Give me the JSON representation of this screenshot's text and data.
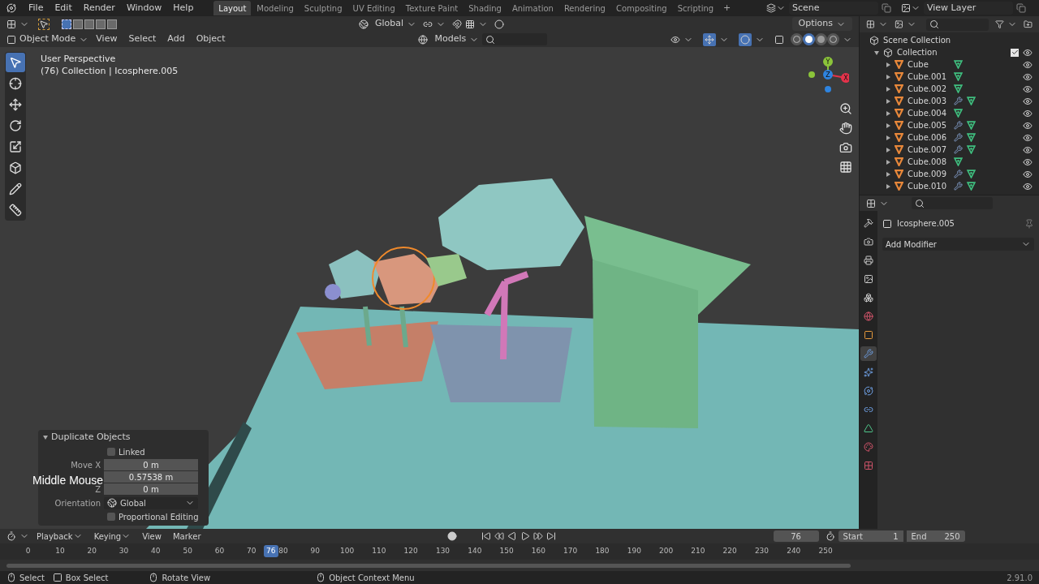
{
  "menubar": {
    "menus": [
      "File",
      "Edit",
      "Render",
      "Window",
      "Help"
    ]
  },
  "workspace_tabs": [
    {
      "label": "Layout",
      "selected": true
    },
    {
      "label": "Modeling",
      "selected": false
    },
    {
      "label": "Sculpting",
      "selected": false
    },
    {
      "label": "UV Editing",
      "selected": false
    },
    {
      "label": "Texture Paint",
      "selected": false
    },
    {
      "label": "Shading",
      "selected": false
    },
    {
      "label": "Animation",
      "selected": false
    },
    {
      "label": "Rendering",
      "selected": false
    },
    {
      "label": "Compositing",
      "selected": false
    },
    {
      "label": "Scripting",
      "selected": false
    }
  ],
  "add_tab": "+",
  "scene": "Scene",
  "view_layer": "View Layer",
  "viewport": {
    "mode": "Object Mode",
    "menus": [
      "View",
      "Select",
      "Add",
      "Object"
    ],
    "orientation": "Global",
    "snap_target": "Models",
    "options": "Options",
    "select_modes": [
      {
        "selected": true
      },
      {
        "selected": false
      },
      {
        "selected": false
      },
      {
        "selected": false
      },
      {
        "selected": false
      }
    ],
    "info_lines": [
      "User Perspective",
      "(76) Collection | Icosphere.005"
    ],
    "tools": [
      {
        "kind": "select",
        "selected": true
      },
      {
        "kind": "cursor",
        "selected": false
      },
      {
        "kind": "move",
        "selected": false
      },
      {
        "kind": "rotate",
        "selected": false
      },
      {
        "kind": "scale",
        "selected": false
      },
      {
        "kind": "transform",
        "selected": false
      },
      {
        "kind": "annotate",
        "selected": false
      },
      {
        "kind": "measure",
        "selected": false
      }
    ],
    "shading_modes": [
      {
        "kind": "wireframe",
        "selected": false
      },
      {
        "kind": "solid",
        "selected": true
      },
      {
        "kind": "material",
        "selected": false
      },
      {
        "kind": "rendered",
        "selected": false
      }
    ],
    "gizmo_axes": [
      {
        "label": "X",
        "color": "#e5334b"
      },
      {
        "label": "Y",
        "color": "#8bc43a"
      },
      {
        "label": "Z",
        "color": "#2e84e0"
      }
    ]
  },
  "operator_panel": {
    "title": "Duplicate Objects",
    "expanded": true,
    "linked": {
      "label": "Linked",
      "checked": false
    },
    "fields": [
      {
        "label": "Move X",
        "value": "0 m"
      },
      {
        "value": "0.57538 m"
      },
      {
        "label": "Z",
        "value": "0 m"
      }
    ],
    "orientation": {
      "label": "Orientation",
      "value": "Global"
    },
    "proportional": {
      "label": "Proportional Editing",
      "checked": false
    }
  },
  "key_overlay": "Middle Mouse",
  "outliner": {
    "root": "Scene Collection",
    "collection": {
      "name": "Collection",
      "expanded": true,
      "checked": true,
      "children": [
        {
          "name": "Cube",
          "modifier": false
        },
        {
          "name": "Cube.001",
          "modifier": false
        },
        {
          "name": "Cube.002",
          "modifier": false
        },
        {
          "name": "Cube.003",
          "modifier": true
        },
        {
          "name": "Cube.004",
          "modifier": false
        },
        {
          "name": "Cube.005",
          "modifier": true
        },
        {
          "name": "Cube.006",
          "modifier": true
        },
        {
          "name": "Cube.007",
          "modifier": true
        },
        {
          "name": "Cube.008",
          "modifier": false
        },
        {
          "name": "Cube.009",
          "modifier": true
        },
        {
          "name": "Cube.010",
          "modifier": true
        }
      ]
    }
  },
  "properties": {
    "object": "Icosphere.005",
    "add_button": "Add Modifier",
    "tabs": [
      {
        "kind": "tool",
        "selected": false
      },
      {
        "kind": "render",
        "selected": false
      },
      {
        "kind": "output",
        "selected": false
      },
      {
        "kind": "view_layer",
        "selected": false
      },
      {
        "kind": "scene",
        "selected": false
      },
      {
        "kind": "world",
        "selected": false
      },
      {
        "kind": "object",
        "selected": false
      },
      {
        "kind": "modifier",
        "selected": true
      },
      {
        "kind": "particles",
        "selected": false
      },
      {
        "kind": "physics",
        "selected": false
      },
      {
        "kind": "constraints",
        "selected": false
      },
      {
        "kind": "data",
        "selected": false
      },
      {
        "kind": "material",
        "selected": false
      },
      {
        "kind": "texture",
        "selected": false
      }
    ]
  },
  "timeline": {
    "menus": [
      "Playback",
      "Keying",
      "View",
      "Marker"
    ],
    "current_frame": "76",
    "start": {
      "label": "Start",
      "value": "1"
    },
    "end": {
      "label": "End",
      "value": "250"
    },
    "ticks": [
      "0",
      "10",
      "20",
      "30",
      "40",
      "50",
      "60",
      "70",
      "80",
      "90",
      "100",
      "110",
      "120",
      "130",
      "140",
      "150",
      "160",
      "170",
      "180",
      "190",
      "200",
      "210",
      "220",
      "230",
      "240",
      "250"
    ],
    "playhead": {
      "label": "76",
      "level": 0.304
    }
  },
  "status_bar": {
    "items": [
      {
        "kind": "mouse_left",
        "label": "Select"
      },
      {
        "kind": "box",
        "label": "Box Select"
      },
      {
        "kind": "mouse_middle",
        "label": "Rotate View"
      },
      {
        "kind": "mouse_right",
        "label": "Object Context Menu"
      }
    ],
    "version": "2.91.0"
  }
}
